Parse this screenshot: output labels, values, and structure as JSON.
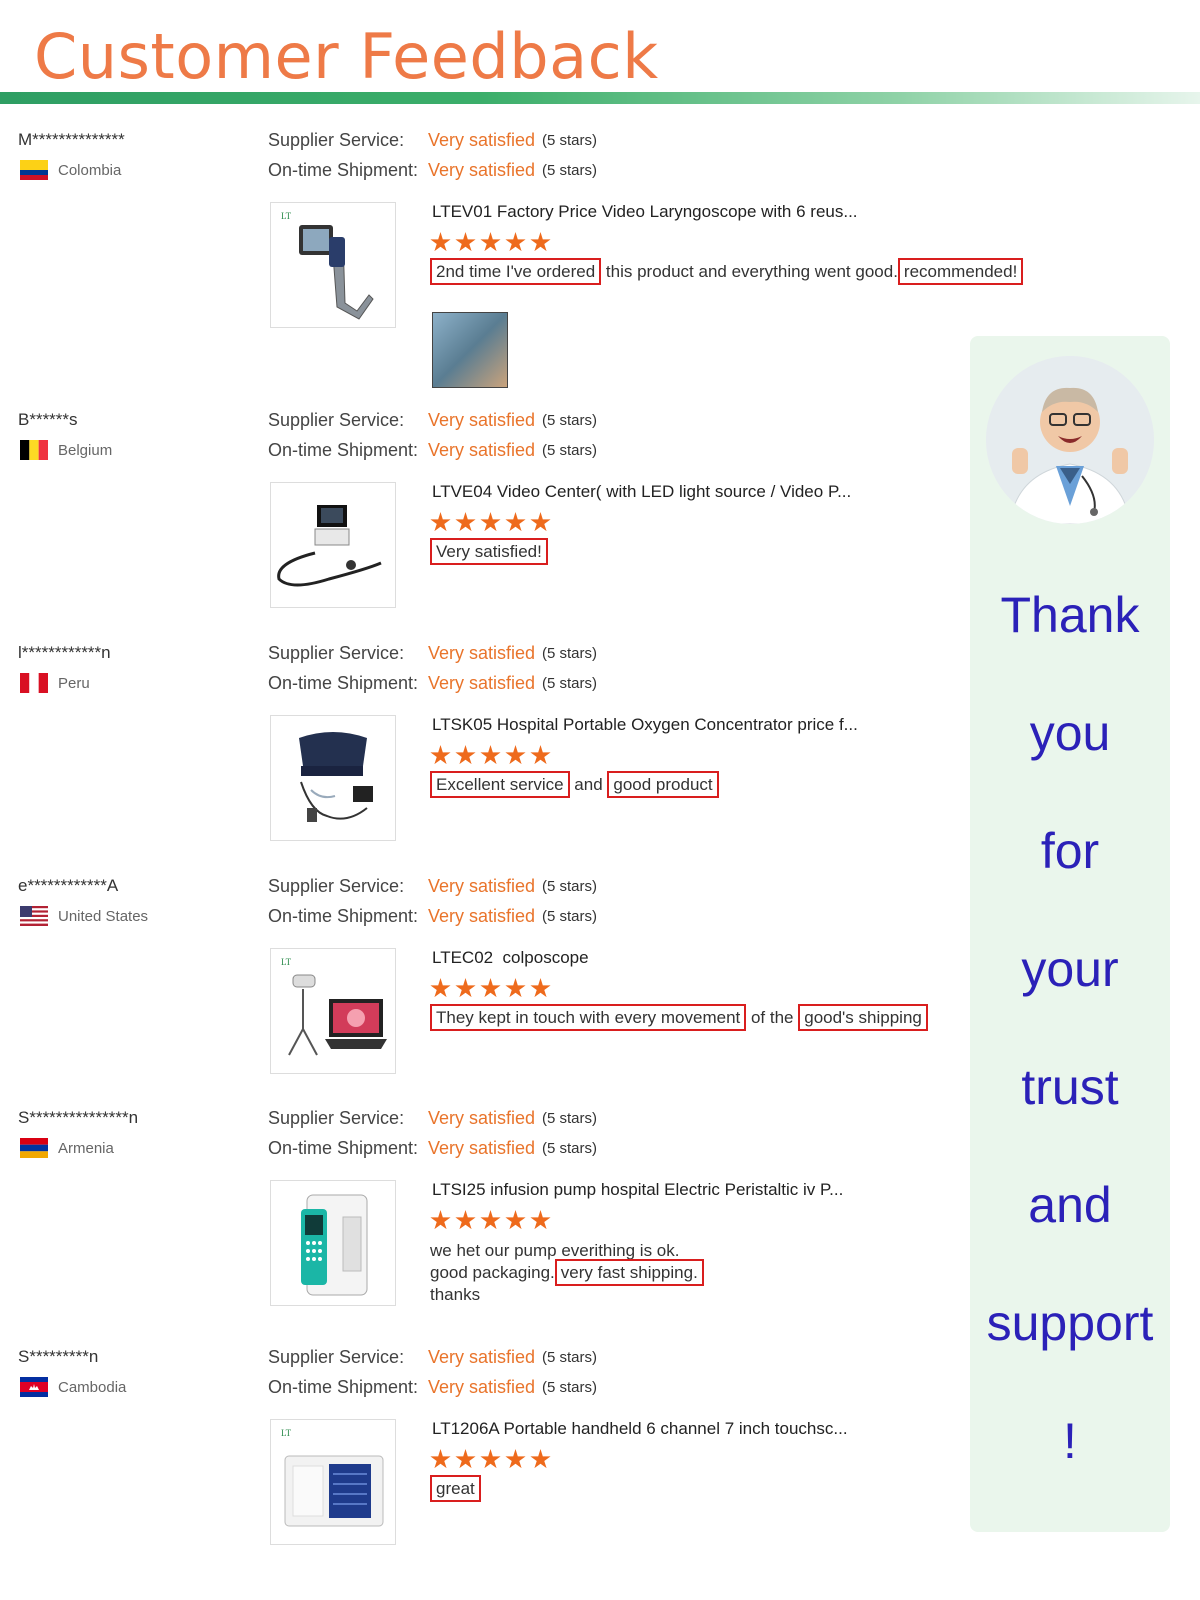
{
  "header": {
    "title": "Customer Feedback"
  },
  "labels": {
    "supplier": "Supplier Service:",
    "shipment": "On-time Shipment:"
  },
  "reviews": [
    {
      "customer": "M**************",
      "country": "Colombia",
      "flag": "colombia",
      "supplier_value": "Very satisfied",
      "supplier_count": "(5 stars)",
      "shipment_value": "Very satisfied",
      "shipment_count": "(5 stars)",
      "product": "LTEV01 Factory Price Video Laryngoscope with 6 reus...",
      "stars": 5,
      "comment": [
        {
          "t": "2nd time I've ordered",
          "hl": true
        },
        {
          "t": " this product and everything went good.",
          "hl": false
        },
        {
          "t": "recommended!",
          "hl": true
        }
      ],
      "has_photo": true
    },
    {
      "customer": "B******s",
      "country": "Belgium",
      "flag": "belgium",
      "supplier_value": "Very satisfied",
      "supplier_count": "(5 stars)",
      "shipment_value": "Very satisfied",
      "shipment_count": "(5 stars)",
      "product": "LTVE04 Video Center( with LED light source / Video P...",
      "stars": 5,
      "comment": [
        {
          "t": "Very satisfied!",
          "hl": true
        }
      ]
    },
    {
      "customer": "l************n",
      "country": "Peru",
      "flag": "peru",
      "supplier_value": "Very satisfied",
      "supplier_count": "(5 stars)",
      "shipment_value": "Very satisfied",
      "shipment_count": "(5 stars)",
      "product": "LTSK05 Hospital Portable Oxygen Concentrator price f...",
      "stars": 5,
      "comment": [
        {
          "t": "Excellent service",
          "hl": true
        },
        {
          "t": " and ",
          "hl": false
        },
        {
          "t": "good product",
          "hl": true
        }
      ]
    },
    {
      "customer": "e************A",
      "country": "United States",
      "flag": "usa",
      "supplier_value": "Very satisfied",
      "supplier_count": "(5 stars)",
      "shipment_value": "Very satisfied",
      "shipment_count": "(5 stars)",
      "product": "LTEC02  colposcope",
      "stars": 5,
      "comment": [
        {
          "t": "They kept in touch with every movement",
          "hl": true
        },
        {
          "t": " of the ",
          "hl": false
        },
        {
          "t": "good's shipping",
          "hl": true
        }
      ]
    },
    {
      "customer": "S***************n",
      "country": "Armenia",
      "flag": "armenia",
      "supplier_value": "Very satisfied",
      "supplier_count": "(5 stars)",
      "shipment_value": "Very satisfied",
      "shipment_count": "(5 stars)",
      "product": "LTSI25 infusion pump hospital Electric Peristaltic iv P...",
      "stars": 5,
      "comment_lines": [
        "we het our pump everithing is ok.",
        "good packaging.",
        "very fast shipping.",
        "thanks"
      ]
    },
    {
      "customer": "S*********n",
      "country": "Cambodia",
      "flag": "cambodia",
      "supplier_value": "Very satisfied",
      "supplier_count": "(5 stars)",
      "shipment_value": "Very satisfied",
      "shipment_count": "(5 stars)",
      "product": "LT1206A Portable handheld 6 channel 7 inch touchsc...",
      "stars": 5,
      "comment": [
        {
          "t": "great",
          "hl": true
        }
      ]
    }
  ],
  "sidebar": {
    "words": [
      "Thank",
      "you",
      "for",
      "your",
      "trust",
      "and",
      "support",
      "!"
    ]
  }
}
